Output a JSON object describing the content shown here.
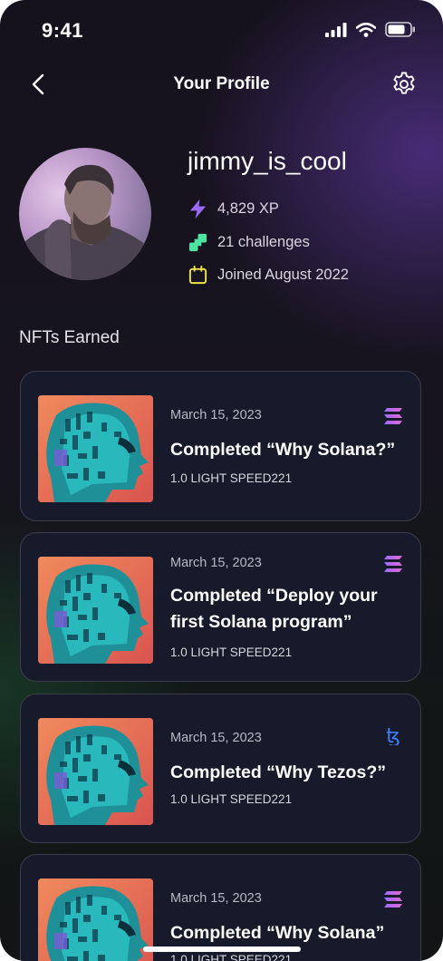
{
  "status": {
    "time": "9:41"
  },
  "header": {
    "title": "Your Profile"
  },
  "profile": {
    "username": "jimmy_is_cool",
    "xp": "4,829 XP",
    "challenges": "21 challenges",
    "joined": "Joined August 2022"
  },
  "colors": {
    "accent_purple": "#9b6bff",
    "accent_green": "#4fe3a1",
    "accent_yellow": "#f0e34a",
    "tezos_blue": "#3d7cf5"
  },
  "nfts": {
    "heading": "NFTs Earned",
    "items": [
      {
        "date": "March 15, 2023",
        "title": "Completed “Why Solana?”",
        "subtitle": "1.0 LIGHT SPEED221",
        "chain_icon": "solana-icon"
      },
      {
        "date": "March 15, 2023",
        "title": "Completed “Deploy your first Solana program”",
        "subtitle": "1.0 LIGHT SPEED221",
        "chain_icon": "solana-icon"
      },
      {
        "date": "March 15, 2023",
        "title": "Completed “Why Tezos?”",
        "subtitle": "1.0 LIGHT SPEED221",
        "chain_icon": "tezos-icon"
      },
      {
        "date": "March 15, 2023",
        "title": "Completed “Why Solana”",
        "subtitle": "1.0 LIGHT SPEED221",
        "chain_icon": "solana-icon"
      }
    ]
  }
}
